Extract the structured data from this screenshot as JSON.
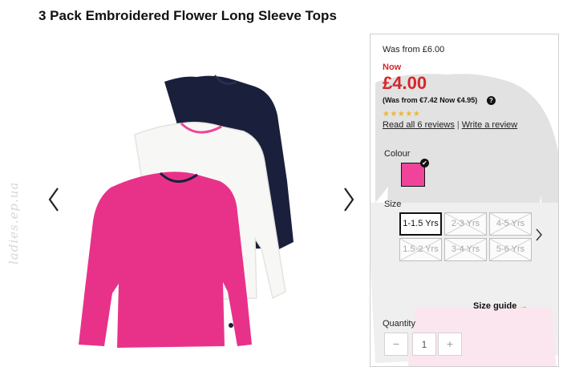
{
  "product": {
    "title": "3 Pack Embroidered Flower Long Sleeve Tops"
  },
  "watermark": "ladies.ep.ua",
  "gallery": {
    "prev_icon": "chevron-left-icon",
    "next_icon": "chevron-right-icon"
  },
  "pricing": {
    "was_from": "Was from £6.00",
    "now_label": "Now",
    "price": "£4.00",
    "was_eur": "(Was from €7.42 Now €4.95)",
    "help_icon_text": "?",
    "rating_stars": 5,
    "stars_text": "★★★★★",
    "read_reviews": "Read all 6 reviews",
    "separator": "|",
    "write_review": "Write a review"
  },
  "colour": {
    "label": "Colour",
    "selected_value": "#f0449b",
    "check_icon": "✔"
  },
  "size": {
    "label": "Size",
    "options": [
      {
        "label": "1-1.5 Yrs",
        "available": true,
        "selected": true
      },
      {
        "label": "2-3 Yrs",
        "available": false,
        "selected": false
      },
      {
        "label": "4-5 Yrs",
        "available": false,
        "selected": false
      },
      {
        "label": "1.5-2 Yrs",
        "available": false,
        "selected": false
      },
      {
        "label": "3-4 Yrs",
        "available": false,
        "selected": false
      },
      {
        "label": "5-6 Yrs",
        "available": false,
        "selected": false
      }
    ],
    "next_icon": "chevron-right-icon",
    "guide_label": "Size guide",
    "guide_arrow": "→"
  },
  "quantity": {
    "label": "Quantity",
    "minus": "−",
    "value": "1",
    "plus": "+"
  },
  "colors": {
    "price_red": "#d6262a",
    "pink": "#f0449b",
    "navy": "#1a1f3c",
    "star": "#f0b62c"
  }
}
